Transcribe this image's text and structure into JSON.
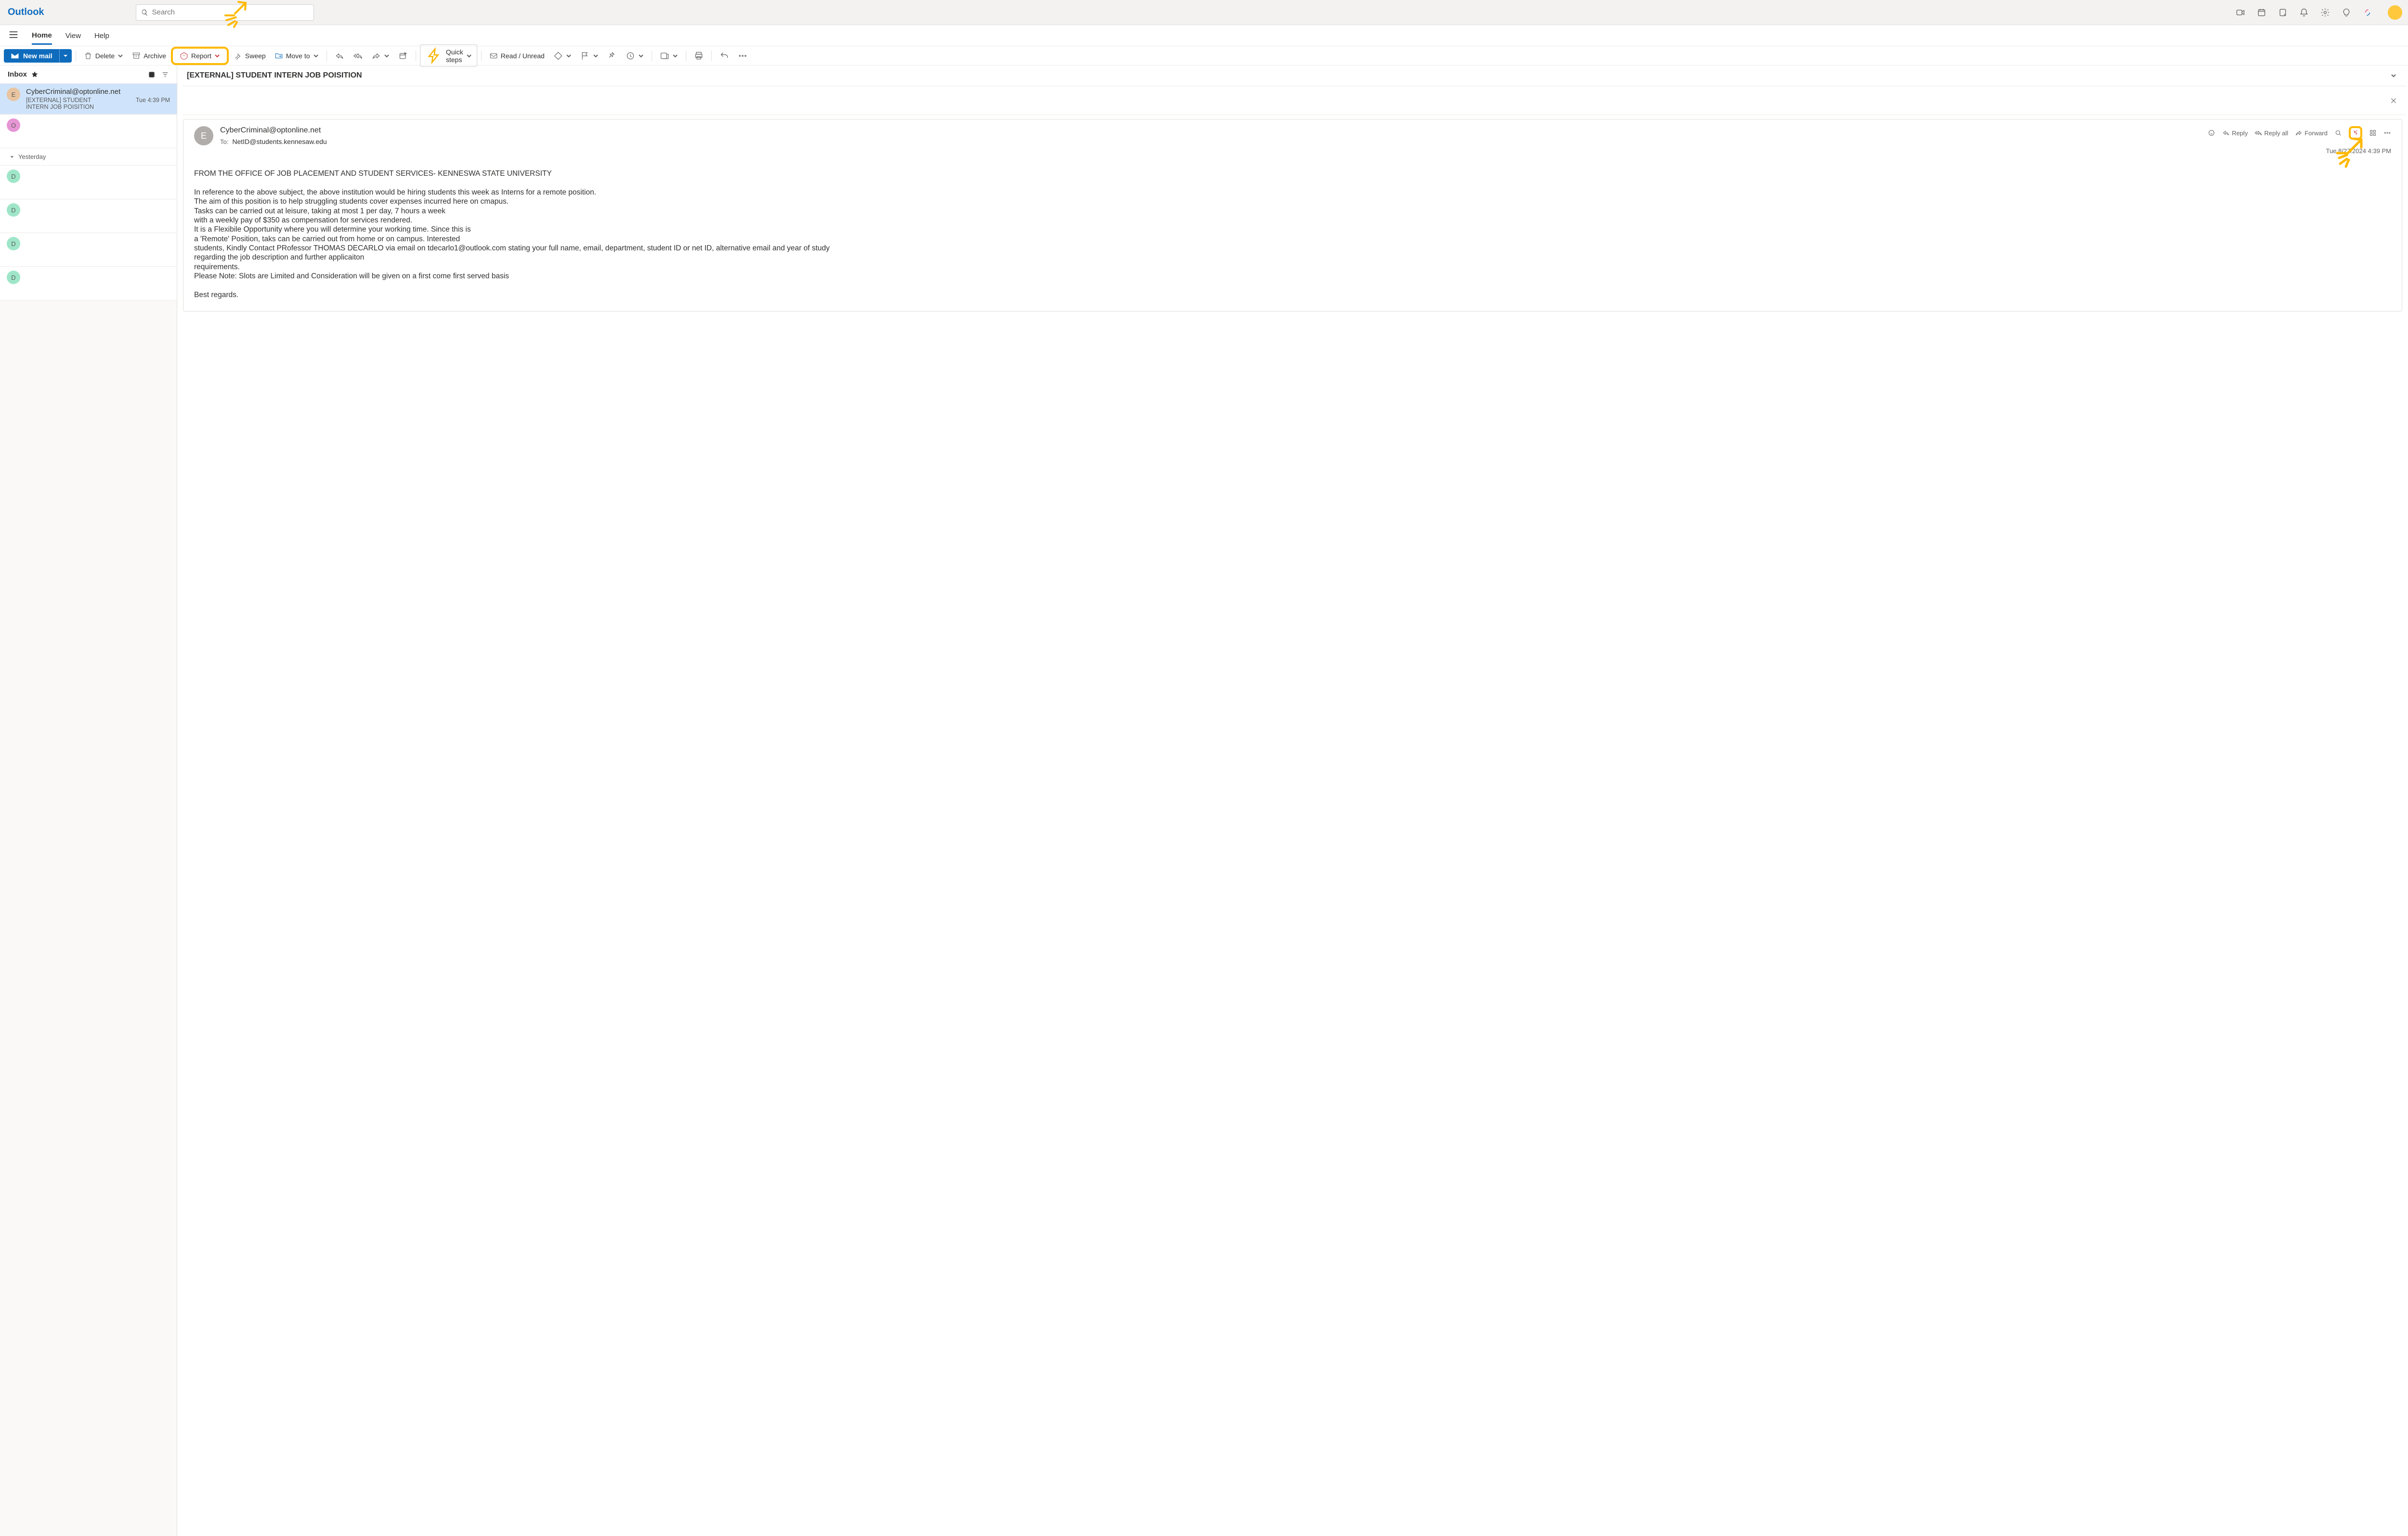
{
  "brand": "Outlook",
  "search": {
    "placeholder": "Search"
  },
  "tabs": {
    "home": "Home",
    "view": "View",
    "help": "Help"
  },
  "toolbar": {
    "new_mail": "New mail",
    "delete": "Delete",
    "archive": "Archive",
    "report": "Report",
    "sweep": "Sweep",
    "move_to": "Move to",
    "quick_steps": "Quick steps",
    "read_unread": "Read / Unread"
  },
  "list": {
    "title": "Inbox",
    "group_yesterday": "Yesterday",
    "items": [
      {
        "avatar": "E",
        "avatar_bg": "#e8c4a0",
        "sender": "CyberCriminal@optonline.net",
        "subject": "[EXTERNAL] STUDENT INTERN JOB POISITION",
        "time": "Tue 4:39 PM",
        "selected": true
      },
      {
        "avatar": "O",
        "avatar_bg": "#e696d4",
        "sender": "",
        "subject": "",
        "time": ""
      },
      {
        "avatar": "D",
        "avatar_bg": "#9fe6c8",
        "sender": "",
        "subject": "",
        "time": ""
      },
      {
        "avatar": "D",
        "avatar_bg": "#9fe6c8",
        "sender": "",
        "subject": "",
        "time": ""
      },
      {
        "avatar": "D",
        "avatar_bg": "#9fe6c8",
        "sender": "",
        "subject": "",
        "time": ""
      },
      {
        "avatar": "D",
        "avatar_bg": "#9fe6c8",
        "sender": "",
        "subject": "",
        "time": ""
      }
    ]
  },
  "reading": {
    "subject": "[EXTERNAL] STUDENT INTERN JOB POISITION",
    "from": "CyberCriminal@optonline.net",
    "to_label": "To:",
    "to": "NetID@students.kennesaw.edu",
    "actions": {
      "reply": "Reply",
      "reply_all": "Reply all",
      "forward": "Forward"
    },
    "datetime": "Tue 8/27/2024 4:39 PM",
    "body": "FROM THE OFFICE OF JOB PLACEMENT AND STUDENT SERVICES- KENNESWA STATE UNIVERSITY\n\nIn reference to the above subject, the above institution would be hiring students this week as Interns for a remote position.\nThe aim of this position is to help struggling students cover expenses incurred here on cmapus.\nTasks can be carried out at leisure, taking at most 1 per day, 7 hours a week\nwith a weekly pay of $350 as compensation for services rendered.\nIt is a Flexibile Opportunity where you will determine your working time. Since this is\na 'Remote' Position, taks can be carried out from home or on campus. Interested\nstudents, Kindly Contact PRofessor THOMAS DECARLO via email on tdecarlo1@outlook.com stating your full name, email, department, student ID or net ID, alternative email and year of study\nregarding the job description and further applicaiton\nrequirements.\nPlease Note: Slots are Limited and Consideration will be given on a first come first served basis\n\nBest regards."
  }
}
